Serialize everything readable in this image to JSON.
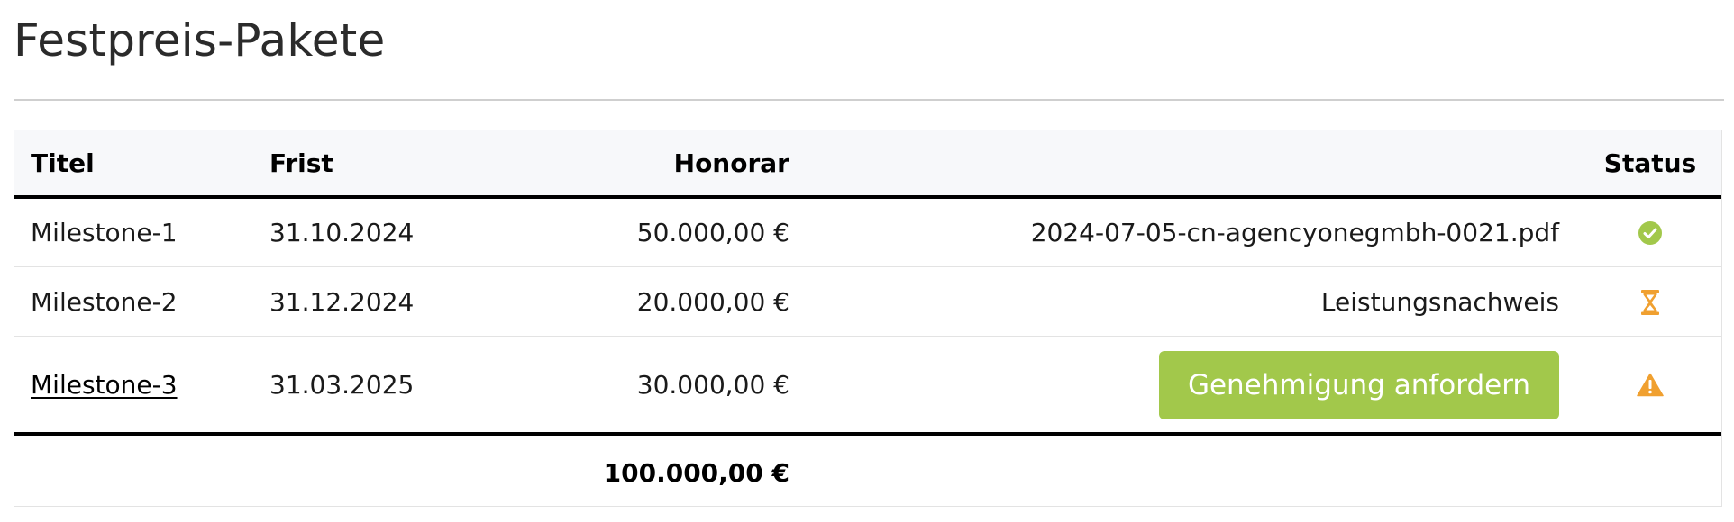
{
  "page": {
    "title": "Festpreis-Pakete"
  },
  "table": {
    "headers": {
      "titel": "Titel",
      "frist": "Frist",
      "honorar": "Honorar",
      "document": "",
      "status": "Status"
    },
    "rows": [
      {
        "titel": "Milestone-1",
        "frist": "31.10.2024",
        "honorar": "50.000,00 €",
        "document": "2024-07-05-cn-agencyonegmbh-0021.pdf",
        "status_icon": "check-circle-icon"
      },
      {
        "titel": "Milestone-2",
        "frist": "31.12.2024",
        "honorar": "20.000,00 €",
        "document": "Leistungsnachweis",
        "status_icon": "hourglass-icon"
      },
      {
        "titel": "Milestone-3",
        "frist": "31.03.2025",
        "honorar": "30.000,00 €",
        "action_label": "Genehmigung anfordern",
        "status_icon": "warning-icon"
      }
    ],
    "total": "100.000,00 €"
  },
  "colors": {
    "success": "#a2c84b",
    "pending": "#f0a030",
    "warning": "#f0a030",
    "button": "#a2c84b"
  }
}
